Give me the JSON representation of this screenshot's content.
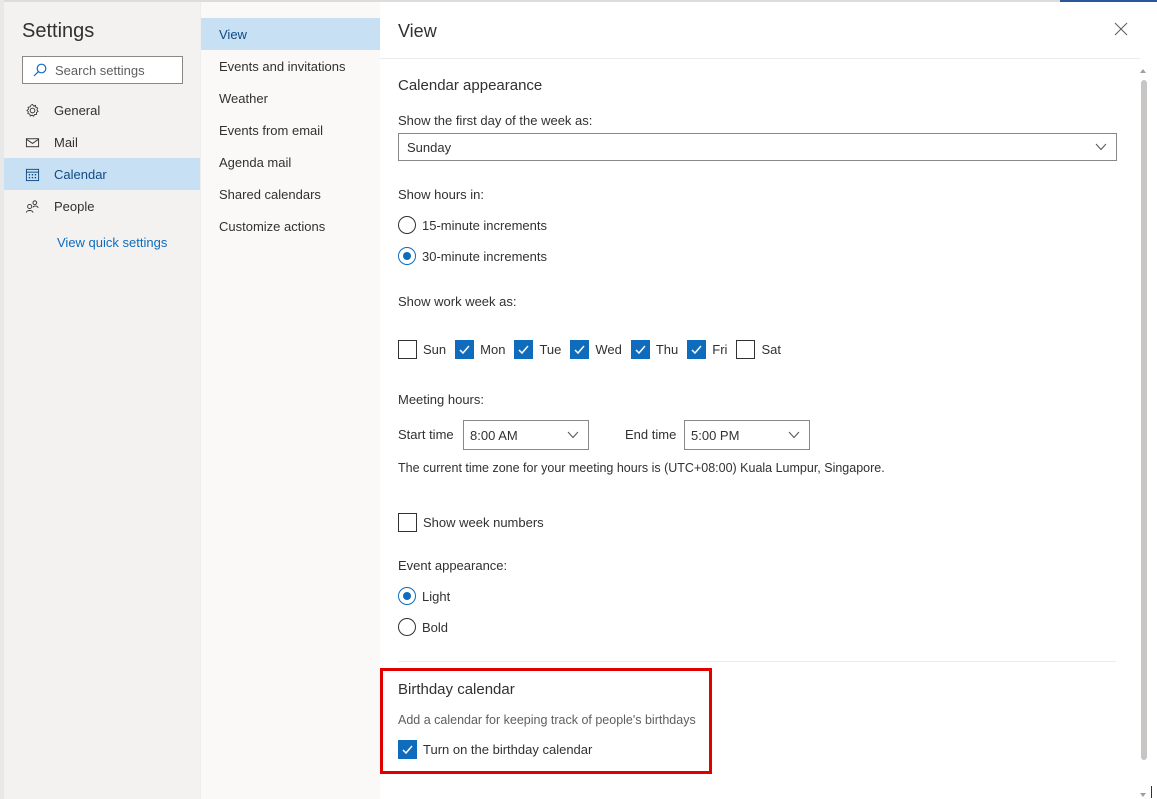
{
  "settings": {
    "title": "Settings",
    "search_placeholder": "Search settings",
    "nav": [
      {
        "label": "General",
        "icon": "gear-icon"
      },
      {
        "label": "Mail",
        "icon": "mail-icon"
      },
      {
        "label": "Calendar",
        "icon": "calendar-icon",
        "active": true
      },
      {
        "label": "People",
        "icon": "people-icon"
      }
    ],
    "quick_settings_link": "View quick settings"
  },
  "subnav": {
    "items": [
      {
        "label": "View",
        "active": true
      },
      {
        "label": "Events and invitations"
      },
      {
        "label": "Weather"
      },
      {
        "label": "Events from email"
      },
      {
        "label": "Agenda mail"
      },
      {
        "label": "Shared calendars"
      },
      {
        "label": "Customize actions"
      }
    ]
  },
  "main": {
    "title": "View",
    "close_icon": "close-icon",
    "calendar_appearance": {
      "title": "Calendar appearance",
      "first_day_label": "Show the first day of the week as:",
      "first_day_value": "Sunday",
      "hours_label": "Show hours in:",
      "hours_options": [
        {
          "label": "15-minute increments",
          "checked": false
        },
        {
          "label": "30-minute increments",
          "checked": true
        }
      ],
      "work_week_label": "Show work week as:",
      "days": [
        {
          "label": "Sun",
          "checked": false
        },
        {
          "label": "Mon",
          "checked": true
        },
        {
          "label": "Tue",
          "checked": true
        },
        {
          "label": "Wed",
          "checked": true
        },
        {
          "label": "Thu",
          "checked": true
        },
        {
          "label": "Fri",
          "checked": true
        },
        {
          "label": "Sat",
          "checked": false
        }
      ],
      "meeting_hours_label": "Meeting hours:",
      "start_time_label": "Start time",
      "start_time_value": "8:00 AM",
      "end_time_label": "End time",
      "end_time_value": "5:00 PM",
      "timezone_note": "The current time zone for your meeting hours is (UTC+08:00) Kuala Lumpur, Singapore.",
      "week_numbers_label": "Show week numbers",
      "week_numbers_checked": false,
      "event_appearance_label": "Event appearance:",
      "event_options": [
        {
          "label": "Light",
          "checked": true
        },
        {
          "label": "Bold",
          "checked": false
        }
      ]
    },
    "birthday": {
      "title": "Birthday calendar",
      "description": "Add a calendar for keeping track of people's birthdays",
      "toggle_label": "Turn on the birthday calendar",
      "toggle_checked": true
    }
  },
  "colors": {
    "accent": "#0f6cbd",
    "highlight": "#e00000",
    "active_bg": "#c7e0f4"
  }
}
